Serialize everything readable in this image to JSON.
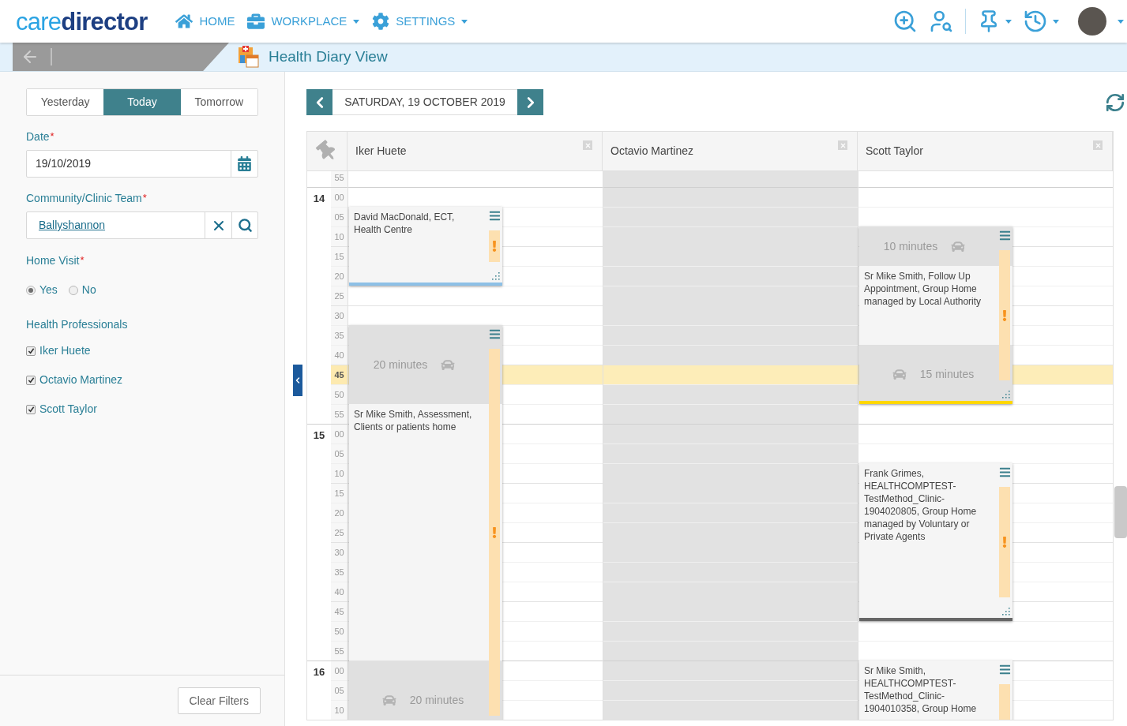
{
  "header": {
    "logo": {
      "light": "care",
      "dark": "director"
    },
    "nav": [
      {
        "label": "HOME",
        "dropdown": false
      },
      {
        "label": "WORKPLACE",
        "dropdown": true
      },
      {
        "label": "SETTINGS",
        "dropdown": true
      }
    ]
  },
  "breadcrumb": {
    "title": "Health Diary View"
  },
  "sidebar": {
    "day_tabs": [
      {
        "label": "Yesterday",
        "selected": false
      },
      {
        "label": "Today",
        "selected": true
      },
      {
        "label": "Tomorrow",
        "selected": false
      }
    ],
    "date_field": {
      "label": "Date",
      "required_mark": "*",
      "value": "19/10/2019"
    },
    "team_field": {
      "label": "Community/Clinic Team",
      "required_mark": "*",
      "value": "Ballyshannon"
    },
    "home_visit": {
      "label": "Home Visit",
      "required_mark": "*",
      "options": [
        {
          "label": "Yes",
          "selected": true
        },
        {
          "label": "No",
          "selected": false
        }
      ]
    },
    "professionals": {
      "label": "Health Professionals",
      "items": [
        {
          "label": "Iker Huete",
          "checked": true
        },
        {
          "label": "Octavio Martinez",
          "checked": true
        },
        {
          "label": "Scott Taylor",
          "checked": true
        }
      ]
    },
    "clear_button": "Clear Filters"
  },
  "diary": {
    "date": "SATURDAY, 19 OCTOBER 2019",
    "rows": [
      {
        "minute": "55",
        "current": false
      },
      {
        "hour": "14",
        "minute": "00",
        "current": false
      },
      {
        "minute": "05",
        "current": false
      },
      {
        "minute": "10",
        "current": false
      },
      {
        "minute": "15",
        "current": false
      },
      {
        "minute": "20",
        "current": false
      },
      {
        "minute": "25",
        "current": false
      },
      {
        "minute": "30",
        "current": false
      },
      {
        "minute": "35",
        "current": false
      },
      {
        "minute": "40",
        "current": false
      },
      {
        "minute": "45",
        "current": true
      },
      {
        "minute": "50",
        "current": false
      },
      {
        "minute": "55",
        "current": false
      },
      {
        "hour": "15",
        "minute": "00",
        "current": false
      },
      {
        "minute": "05",
        "current": false
      },
      {
        "minute": "10",
        "current": false
      },
      {
        "minute": "15",
        "current": false
      },
      {
        "minute": "20",
        "current": false
      },
      {
        "minute": "25",
        "current": false
      },
      {
        "minute": "30",
        "current": false
      },
      {
        "minute": "35",
        "current": false
      },
      {
        "minute": "40",
        "current": false
      },
      {
        "minute": "45",
        "current": false
      },
      {
        "minute": "50",
        "current": false
      },
      {
        "minute": "55",
        "current": false
      },
      {
        "hour": "16",
        "minute": "00",
        "current": false
      },
      {
        "minute": "05",
        "current": false
      },
      {
        "minute": "10",
        "current": false
      }
    ],
    "columns": [
      {
        "name": "Iker Huete",
        "unavailable": false,
        "events": [
          {
            "color": "#8dc0e6",
            "alert": true,
            "segments": [
              {
                "kind": "appointment",
                "text": "David MacDonald, ECT, Health Centre"
              }
            ]
          },
          {
            "alert": true,
            "segments": [
              {
                "kind": "travel",
                "text": "20 minutes",
                "car_first": false
              },
              {
                "kind": "appointment",
                "text": "Sr Mike Smith, Assessment, Clients or patients home"
              },
              {
                "kind": "travel",
                "text": "20 minutes",
                "car_first": true
              }
            ]
          }
        ]
      },
      {
        "name": "Octavio Martinez",
        "unavailable": true
      },
      {
        "name": "Scott Taylor",
        "unavailable": false,
        "events": [
          {
            "color": "#ffd700",
            "alert": true,
            "segments": [
              {
                "kind": "travel",
                "text": "10 minutes",
                "car_first": false
              },
              {
                "kind": "appointment",
                "text": "Sr Mike Smith, Follow Up Appointment, Group Home managed by Local Authority"
              },
              {
                "kind": "travel",
                "text": "15 minutes",
                "car_first": true
              }
            ]
          },
          {
            "color": "#666666",
            "alert": true,
            "segments": [
              {
                "kind": "appointment",
                "text": "Frank Grimes, HEALTHCOMPTEST-TestMethod_Clinic-1904020805, Group Home managed by Voluntary or Private Agents"
              }
            ]
          },
          {
            "alert": true,
            "segments": [
              {
                "kind": "appointment",
                "text": "Sr Mike Smith, HEALTHCOMPTEST-TestMethod_Clinic-1904010358, Group Home"
              }
            ]
          }
        ]
      }
    ]
  }
}
